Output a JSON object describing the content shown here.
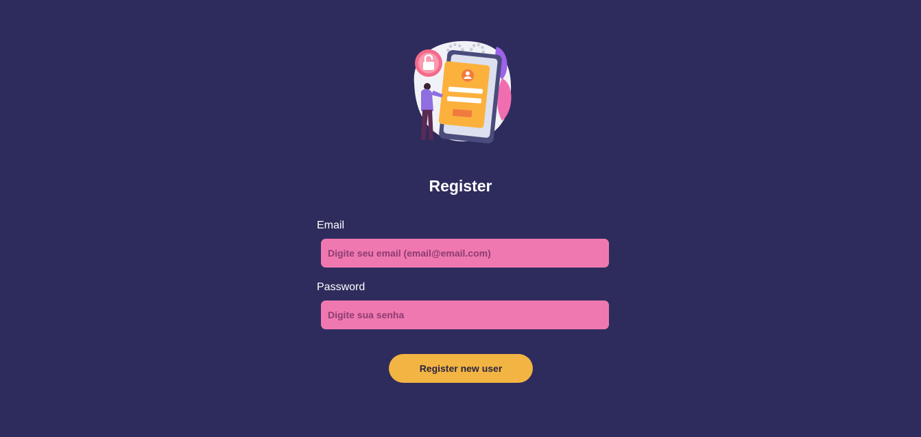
{
  "header": {
    "illustration_icon": "mobile-login-illustration",
    "title": "Register"
  },
  "form": {
    "email": {
      "label": "Email",
      "placeholder": "Digite seu email (email@email.com)",
      "value": ""
    },
    "password": {
      "label": "Password",
      "placeholder": "Digite sua senha",
      "value": ""
    },
    "submit_label": "Register new user"
  },
  "colors": {
    "background": "#2e2c5c",
    "input_background": "#f078b1",
    "button_background": "#f2b443",
    "text": "#ffffff"
  }
}
